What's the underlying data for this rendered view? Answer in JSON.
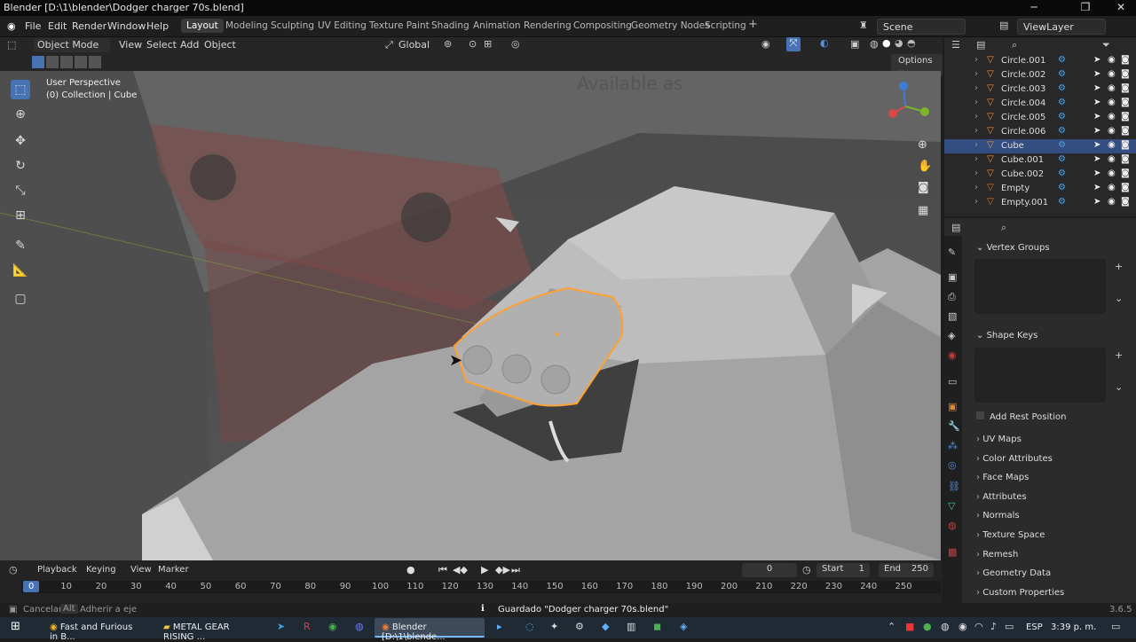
{
  "titlebar": {
    "title": "Blender [D:\\1\\blender\\Dodger charger 70s.blend]"
  },
  "menu": [
    "File",
    "Edit",
    "Render",
    "Window",
    "Help"
  ],
  "workspaces": [
    "Layout",
    "Modeling",
    "Sculpting",
    "UV Editing",
    "Texture Paint",
    "Shading",
    "Animation",
    "Rendering",
    "Compositing",
    "Geometry Nodes",
    "Scripting"
  ],
  "scene": "Scene",
  "view_layer": "ViewLayer",
  "header": {
    "mode": "Object Mode",
    "view": "View",
    "select": "Select",
    "add": "Add",
    "object": "Object",
    "orientation": "Global",
    "options": "Options"
  },
  "viewport": {
    "perspective": "User Perspective",
    "collection": "(0) Collection | Cube",
    "bg_text": "Available as"
  },
  "outliner": [
    {
      "name": "Circle.001",
      "sel": false
    },
    {
      "name": "Circle.002",
      "sel": false
    },
    {
      "name": "Circle.003",
      "sel": false
    },
    {
      "name": "Circle.004",
      "sel": false
    },
    {
      "name": "Circle.005",
      "sel": false
    },
    {
      "name": "Circle.006",
      "sel": false
    },
    {
      "name": "Cube",
      "sel": true
    },
    {
      "name": "Cube.001",
      "sel": false
    },
    {
      "name": "Cube.002",
      "sel": false
    },
    {
      "name": "Empty",
      "sel": false
    },
    {
      "name": "Empty.001",
      "sel": false
    }
  ],
  "properties": {
    "vertex_groups": "Vertex Groups",
    "shape_keys": "Shape Keys",
    "add_rest": "Add Rest Position",
    "panels": [
      "UV Maps",
      "Color Attributes",
      "Face Maps",
      "Attributes",
      "Normals",
      "Texture Space",
      "Remesh",
      "Geometry Data",
      "Custom Properties"
    ]
  },
  "timeline": {
    "playback": "Playback",
    "keying": "Keying",
    "view": "View",
    "marker": "Marker",
    "frame": "0",
    "start_label": "Start",
    "start": "1",
    "end_label": "End",
    "end": "250",
    "ticks": [
      "0",
      "10",
      "20",
      "30",
      "40",
      "50",
      "60",
      "70",
      "80",
      "90",
      "100",
      "110",
      "120",
      "130",
      "140",
      "150",
      "160",
      "170",
      "180",
      "190",
      "200",
      "210",
      "220",
      "230",
      "240",
      "250"
    ]
  },
  "status": {
    "cancel": "Cancelar",
    "alt": "Alt",
    "adherir": "Adherir a eje",
    "saved": "Guardado \"Dodger charger 70s.blend\"",
    "version": "3.6.5"
  },
  "taskbar": {
    "items": [
      "Fast and Furious in B...",
      "METAL GEAR RISING ...",
      "Blender [D:\\1\\blende..."
    ],
    "lang": "ESP",
    "time": "3:39 p. m."
  }
}
